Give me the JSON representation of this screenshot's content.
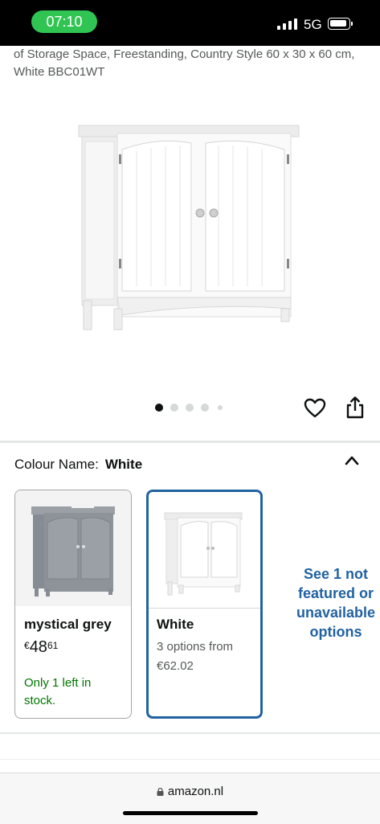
{
  "status_bar": {
    "time": "07:10",
    "network": "5G"
  },
  "product": {
    "title_fragment": "of Storage Space, Freestanding, Country Style 60 x 30 x 60 cm, White BBC01WT",
    "image": "white-under-sink-cabinet"
  },
  "gallery": {
    "dots_count": 5,
    "active_index": 0
  },
  "icons": {
    "favorite": "heart-icon",
    "share": "share-icon",
    "collapse": "chevron-up-icon",
    "lock": "lock-icon"
  },
  "colour": {
    "label": "Colour Name:",
    "selected": "White",
    "options": [
      {
        "name": "mystical grey",
        "price_currency": "€",
        "price_whole": "48",
        "price_fraction": "61",
        "stock": "Only 1 left in stock."
      },
      {
        "name": "White",
        "options_text": "3 options from €62.02"
      }
    ],
    "see_more": "See 1 not featured or unavailable options"
  },
  "colors": {
    "accent": "#2162a1",
    "in_stock": "#007600",
    "time_pill": "#30c552",
    "grey_cabinet": "#8e939a"
  },
  "browser": {
    "url": "amazon.nl"
  }
}
